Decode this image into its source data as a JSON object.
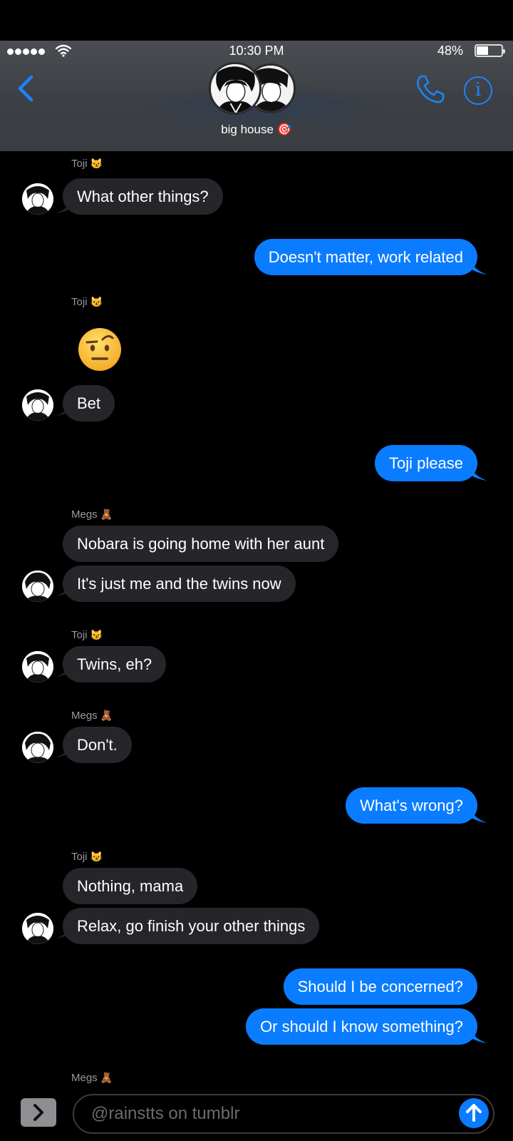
{
  "status_bar": {
    "time": "10:30 PM",
    "battery_percent": "48%",
    "battery_level": 0.48,
    "signal_bars": 5,
    "icons": [
      "signal-dots-icon",
      "wifi-icon",
      "battery-icon"
    ]
  },
  "header": {
    "group_name": "big house 🎯",
    "icons": [
      "chevron-left-icon",
      "phone-icon",
      "info-icon"
    ]
  },
  "colors": {
    "accent": "#0a7cff",
    "incoming_bubble": "#26252a",
    "background": "#000000"
  },
  "messages": {
    "s1": {
      "name": "Toji",
      "emoji": "😼"
    },
    "m1": "What other things?",
    "m2": "Doesn't matter, work related",
    "s2": {
      "name": "Toji",
      "emoji": "😼"
    },
    "m3_emoji": "🤨",
    "m4": "Bet",
    "m5": "Toji please",
    "s3": {
      "name": "Megs",
      "emoji": "🧸"
    },
    "m6": "Nobara is going home with her aunt",
    "m7": "It's just me and the twins now",
    "s4": {
      "name": "Toji",
      "emoji": "😼"
    },
    "m8": "Twins, eh?",
    "s5": {
      "name": "Megs",
      "emoji": "🧸"
    },
    "m9": "Don't.",
    "m10": "What's wrong?",
    "s6": {
      "name": "Toji",
      "emoji": "😼"
    },
    "m11": "Nothing, mama",
    "m12": "Relax, go finish your other things",
    "m13": "Should I be concerned?",
    "m14": "Or should I know something?",
    "s7": {
      "name": "Megs",
      "emoji": "🧸"
    }
  },
  "input": {
    "placeholder": "@rainstts on tumblr",
    "icons": [
      "chevron-right-icon",
      "arrow-up-icon"
    ]
  }
}
